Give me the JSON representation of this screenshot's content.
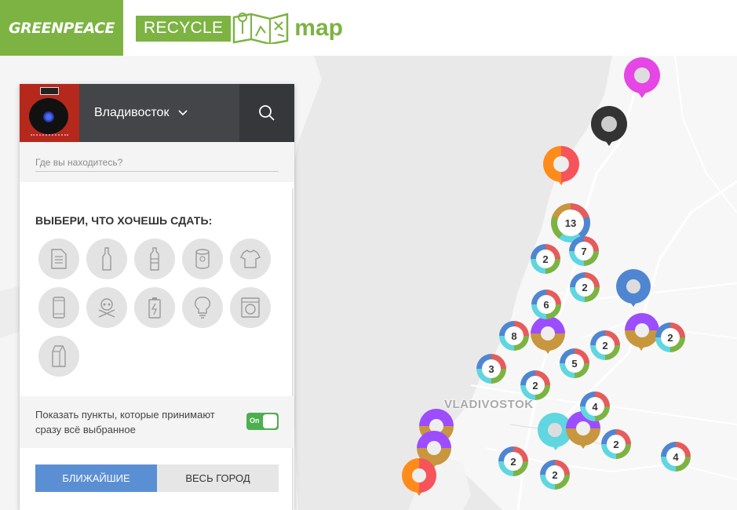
{
  "header": {
    "greenpeace_logo": "GREENPEACE",
    "recycle_word": "RECYCLE",
    "map_word": "map",
    "brand_green": "#7cb342"
  },
  "panel": {
    "city": "Владивосток",
    "location_placeholder": "Где вы находитесь?",
    "choose_title": "ВЫБЕРИ, ЧТО ХОЧЕШЬ СДАТЬ:",
    "categories": [
      {
        "icon": "paper-icon"
      },
      {
        "icon": "glass-bottle-icon"
      },
      {
        "icon": "plastic-bottle-icon"
      },
      {
        "icon": "metal-can-icon"
      },
      {
        "icon": "clothes-icon"
      },
      {
        "icon": "phone-icon"
      },
      {
        "icon": "hazardous-icon"
      },
      {
        "icon": "battery-icon"
      },
      {
        "icon": "lightbulb-icon"
      },
      {
        "icon": "appliance-icon"
      },
      {
        "icon": "tetrapak-icon"
      }
    ],
    "toggle_text": "Показать пункты, которые принимают сразу всё выбранное",
    "toggle_label": "On",
    "toggle_state": true,
    "tab_nearest": "БЛИЖАЙШИЕ",
    "tab_city": "ВЕСЬ ГОРОД",
    "active_tab": "БЛИЖАЙШИЕ"
  },
  "map": {
    "city_label": "VLADIVOSTOK",
    "clusters": [
      {
        "count": "13"
      },
      {
        "count": "2"
      },
      {
        "count": "7"
      },
      {
        "count": "2"
      },
      {
        "count": "6"
      },
      {
        "count": "8"
      },
      {
        "count": "2"
      },
      {
        "count": "2"
      },
      {
        "count": "3"
      },
      {
        "count": "5"
      },
      {
        "count": "2"
      },
      {
        "count": "4"
      },
      {
        "count": "2"
      },
      {
        "count": "2"
      },
      {
        "count": "2"
      },
      {
        "count": "4"
      }
    ]
  }
}
